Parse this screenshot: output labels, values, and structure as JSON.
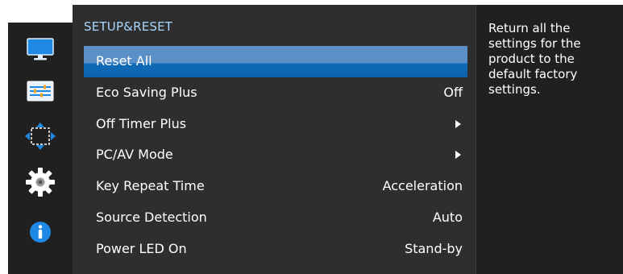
{
  "rail": {
    "icons": [
      "monitor-icon",
      "picture-settings-icon",
      "onscreen-display-icon",
      "system-gear-icon",
      "information-icon"
    ]
  },
  "menu": {
    "title": "SETUP&RESET",
    "items": [
      {
        "label": "Reset All",
        "value": "",
        "arrow": false,
        "selected": true
      },
      {
        "label": "Eco Saving Plus",
        "value": "Off",
        "arrow": false,
        "selected": false
      },
      {
        "label": "Off Timer Plus",
        "value": "",
        "arrow": true,
        "selected": false
      },
      {
        "label": "PC/AV Mode",
        "value": "",
        "arrow": true,
        "selected": false
      },
      {
        "label": "Key Repeat Time",
        "value": "Acceleration",
        "arrow": false,
        "selected": false
      },
      {
        "label": "Source Detection",
        "value": "Auto",
        "arrow": false,
        "selected": false
      },
      {
        "label": "Power LED On",
        "value": "Stand-by",
        "arrow": false,
        "selected": false
      }
    ]
  },
  "help": {
    "text": "Return all the settings for the product to the default factory settings."
  },
  "colors": {
    "rail_bg": "#202020",
    "menu_bg": "#2e2e2e",
    "title": "#a9d6ff",
    "selection": "#0f6bb8",
    "icon_blue": "#1e88e5"
  }
}
